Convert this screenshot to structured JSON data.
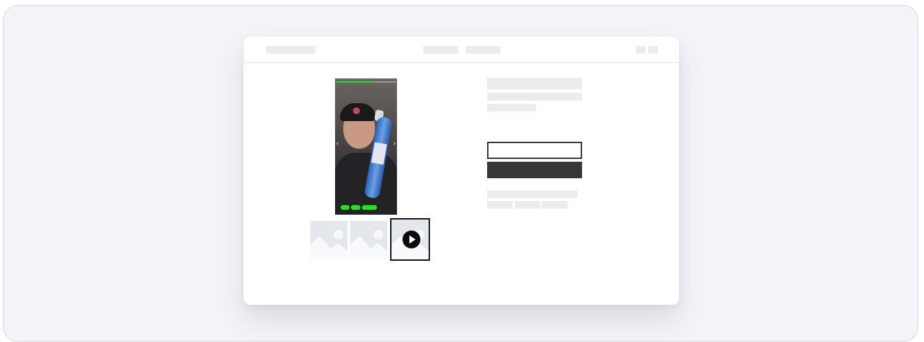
{
  "window": {
    "title": ""
  },
  "header": {
    "logo": "",
    "nav": [
      "",
      ""
    ],
    "icons": [
      "cart-icon",
      "account-icon"
    ]
  },
  "media": {
    "video": {
      "progress": 0.6,
      "chips": [
        "",
        "",
        ""
      ]
    },
    "thumbnails": [
      {
        "type": "image",
        "icon": "image-placeholder-icon"
      },
      {
        "type": "image",
        "icon": "image-placeholder-icon"
      },
      {
        "type": "video",
        "icon": "play-icon",
        "selected": true
      }
    ]
  },
  "product": {
    "title": "",
    "subtitle": "",
    "price": "",
    "input_value": "",
    "button_label": ""
  },
  "colors": {
    "accent": "#22e022",
    "button": "#383838",
    "placeholder": "#ececec"
  }
}
